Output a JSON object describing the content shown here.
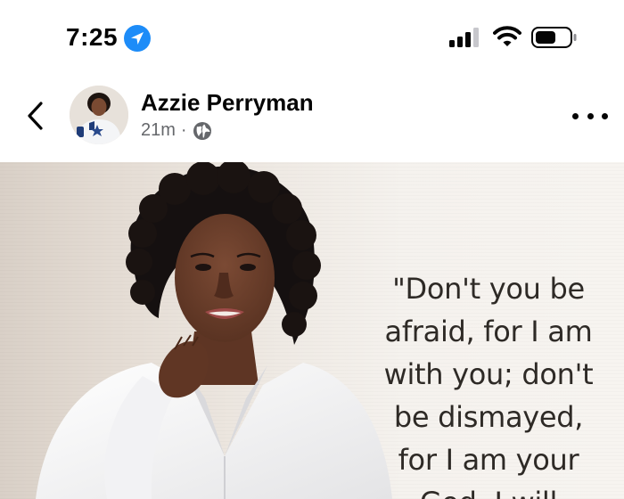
{
  "status_bar": {
    "time": "7:25",
    "location_icon": "location-arrow-icon",
    "signal_icon": "cellular-signal-icon",
    "wifi_icon": "wifi-icon",
    "battery_icon": "battery-icon",
    "accent_color": "#1d8cf8"
  },
  "post": {
    "author": "Azzie Perryman",
    "time_ago": "21m",
    "separator": "·",
    "audience_icon": "globe-icon",
    "back_icon": "chevron-left-icon",
    "more_icon": "more-dots-icon",
    "image": {
      "quote_lines": [
        "\"Don't you be",
        "afraid, for I am",
        "with you; don't",
        "be dismayed,",
        "for I am your",
        "God. I will"
      ]
    }
  }
}
